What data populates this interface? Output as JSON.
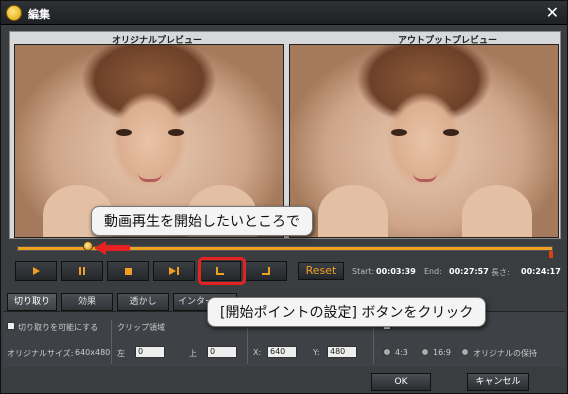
{
  "window": {
    "title": "編集"
  },
  "preview": {
    "original_label": "オリジナルプレビュー",
    "output_label": "アウトプットプレビュー"
  },
  "playback": {
    "progress": 0.12
  },
  "controls": {
    "play_icon": "play-icon",
    "pause_icon": "pause-icon",
    "stop_icon": "stop-icon",
    "next_icon": "next-frame-icon",
    "start_point_icon": "set-start-point-icon",
    "end_point_icon": "set-end-point-icon",
    "reset_label": "Reset",
    "start_label": "Start:",
    "start_value": "00:03:39",
    "end_label": "End:",
    "end_value": "00:27:57",
    "length_label": "長さ:",
    "length_value": "00:24:17"
  },
  "tabs": [
    {
      "label": "切り取り",
      "active": true
    },
    {
      "label": "効果",
      "active": false
    },
    {
      "label": "透かし",
      "active": false
    },
    {
      "label": "インターレース",
      "active": false
    }
  ],
  "settings": {
    "enable_crop": "切り取りを可能にする",
    "original_size_label": "オリジナルサイズ:",
    "original_size_value": "640x480",
    "crop_area": "クリップ領域",
    "left_label": "左",
    "left_value": "0",
    "top_label": "上",
    "top_value": "0",
    "x_label": "X:",
    "x_value": "640",
    "y_label": "Y:",
    "y_value": "480",
    "ratio_43": "4:3",
    "ratio_169": "16:9",
    "ratio_keep": "オリジナルの保持"
  },
  "buttons": {
    "ok": "OK",
    "cancel": "キャンセル"
  },
  "callouts": {
    "top": "動画再生を開始したいところで",
    "bottom": "[開始ポイントの設定] ボタンをクリック"
  },
  "colors": {
    "accent": "#f0a020",
    "highlight": "#e52222"
  }
}
